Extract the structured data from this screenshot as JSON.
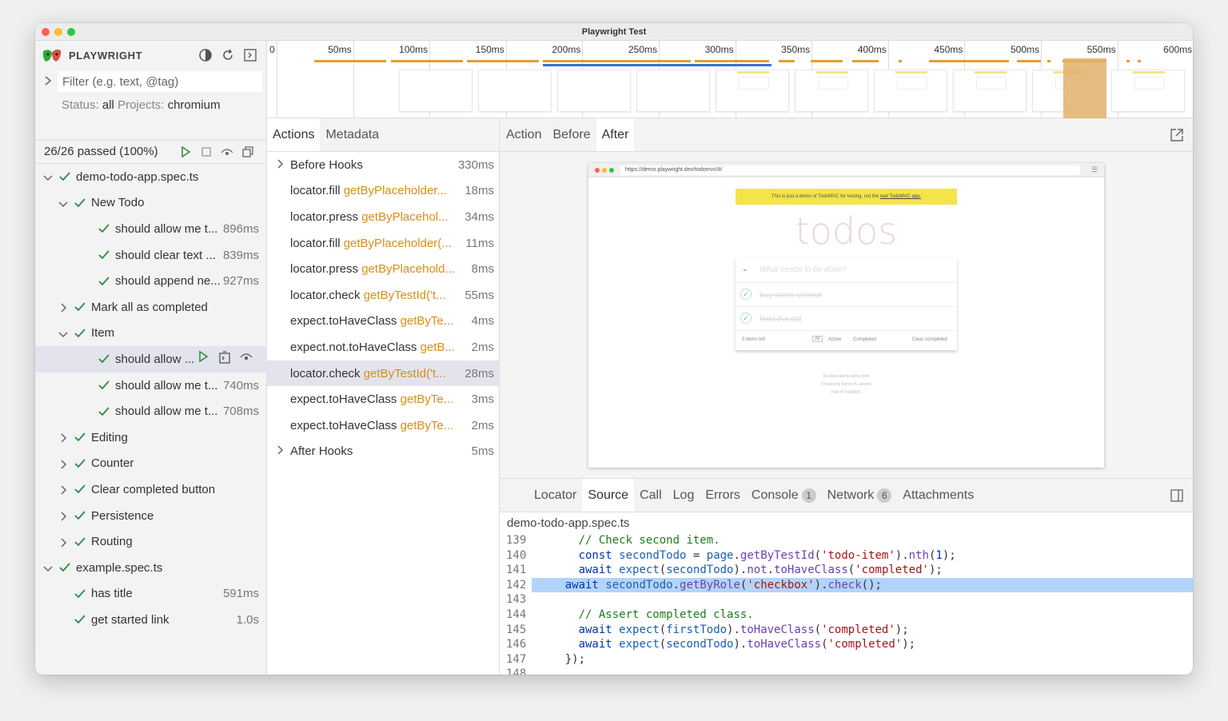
{
  "window": {
    "title": "Playwright Test"
  },
  "sidebar": {
    "brand": "PLAYWRIGHT",
    "filter_placeholder": "Filter (e.g. text, @tag)",
    "status_label": "Status:",
    "status_value": "all",
    "projects_label": "Projects:",
    "projects_value": "chromium",
    "passed": "26/26 passed (100%)",
    "tree": [
      {
        "label": "demo-todo-app.spec.ts",
        "duration": "",
        "level": 0,
        "expanded": true
      },
      {
        "label": "New Todo",
        "duration": "",
        "level": 1,
        "expanded": true
      },
      {
        "label": "should allow me t...",
        "duration": "896ms",
        "level": 2
      },
      {
        "label": "should clear text ...",
        "duration": "839ms",
        "level": 2
      },
      {
        "label": "should append ne...",
        "duration": "927ms",
        "level": 2
      },
      {
        "label": "Mark all as completed",
        "duration": "",
        "level": 1,
        "expanded": false
      },
      {
        "label": "Item",
        "duration": "",
        "level": 1,
        "expanded": true
      },
      {
        "label": "should allow ...",
        "duration": "",
        "level": 2,
        "selected": true
      },
      {
        "label": "should allow me t...",
        "duration": "740ms",
        "level": 2
      },
      {
        "label": "should allow me t...",
        "duration": "708ms",
        "level": 2
      },
      {
        "label": "Editing",
        "duration": "",
        "level": 1,
        "expanded": false
      },
      {
        "label": "Counter",
        "duration": "",
        "level": 1,
        "expanded": false
      },
      {
        "label": "Clear completed button",
        "duration": "",
        "level": 1,
        "expanded": false
      },
      {
        "label": "Persistence",
        "duration": "",
        "level": 1,
        "expanded": false
      },
      {
        "label": "Routing",
        "duration": "",
        "level": 1,
        "expanded": false
      },
      {
        "label": "example.spec.ts",
        "duration": "",
        "level": 0,
        "expanded": true
      },
      {
        "label": "has title",
        "duration": "591ms",
        "level": 1,
        "leaf": true
      },
      {
        "label": "get started link",
        "duration": "1.0s",
        "level": 1,
        "leaf": true
      }
    ]
  },
  "timeline": {
    "ticks": [
      "0",
      "50ms",
      "100ms",
      "150ms",
      "200ms",
      "250ms",
      "300ms",
      "350ms",
      "400ms",
      "450ms",
      "500ms",
      "550ms",
      "600ms"
    ]
  },
  "actions_panel": {
    "tabs": [
      "Actions",
      "Metadata"
    ],
    "items": [
      {
        "method": "Before Hooks",
        "selector": "",
        "duration": "330ms",
        "group": true
      },
      {
        "method": "locator.fill",
        "selector": "getByPlaceholder...",
        "duration": "18ms"
      },
      {
        "method": "locator.press",
        "selector": "getByPlacehol...",
        "duration": "34ms"
      },
      {
        "method": "locator.fill",
        "selector": "getByPlaceholder(...",
        "duration": "11ms"
      },
      {
        "method": "locator.press",
        "selector": "getByPlacehold...",
        "duration": "8ms"
      },
      {
        "method": "locator.check",
        "selector": "getByTestId('t...",
        "duration": "55ms"
      },
      {
        "method": "expect.toHaveClass",
        "selector": "getByTe...",
        "duration": "4ms"
      },
      {
        "method": "expect.not.toHaveClass",
        "selector": "getB...",
        "duration": "2ms"
      },
      {
        "method": "locator.check",
        "selector": "getByTestId('t...",
        "duration": "28ms",
        "selected": true
      },
      {
        "method": "expect.toHaveClass",
        "selector": "getByTe...",
        "duration": "3ms"
      },
      {
        "method": "expect.toHaveClass",
        "selector": "getByTe...",
        "duration": "2ms"
      },
      {
        "method": "After Hooks",
        "selector": "",
        "duration": "5ms",
        "group": true
      }
    ]
  },
  "snapshot": {
    "tabs": [
      "Action",
      "Before",
      "After"
    ],
    "active_tab": "After",
    "url": "https://demo.playwright.dev/todomvc/#/",
    "banner_text": "This is just a demo of TodoMVC for testing, not the",
    "banner_link": "real TodoMVC app.",
    "app_title": "todos",
    "new_todo_placeholder": "What needs to be done?",
    "todos": [
      "buy some cheese",
      "feed the cat"
    ],
    "footer": {
      "count": "0 items left",
      "filters": [
        "All",
        "Active",
        "Completed"
      ],
      "clear": "Clear completed"
    },
    "info": [
      "Double-click to edit a todo",
      "Created by Remo H. Jansen",
      "Part of TodoMVC"
    ]
  },
  "bottom_panel": {
    "tabs": [
      {
        "label": "Locator"
      },
      {
        "label": "Source",
        "active": true
      },
      {
        "label": "Call"
      },
      {
        "label": "Log"
      },
      {
        "label": "Errors"
      },
      {
        "label": "Console",
        "badge": "1"
      },
      {
        "label": "Network",
        "badge": "6"
      },
      {
        "label": "Attachments"
      }
    ],
    "file": "demo-todo-app.spec.ts",
    "lines": [
      "139",
      "140",
      "141",
      "142",
      "143",
      "144",
      "145",
      "146",
      "147",
      "148"
    ],
    "highlight_line": "142"
  },
  "colors": {
    "accent_orange": "#d98e15",
    "pass_green": "#2e8b3a",
    "selection": "#e3e3ee",
    "code_highlight": "#b2d4fa"
  }
}
